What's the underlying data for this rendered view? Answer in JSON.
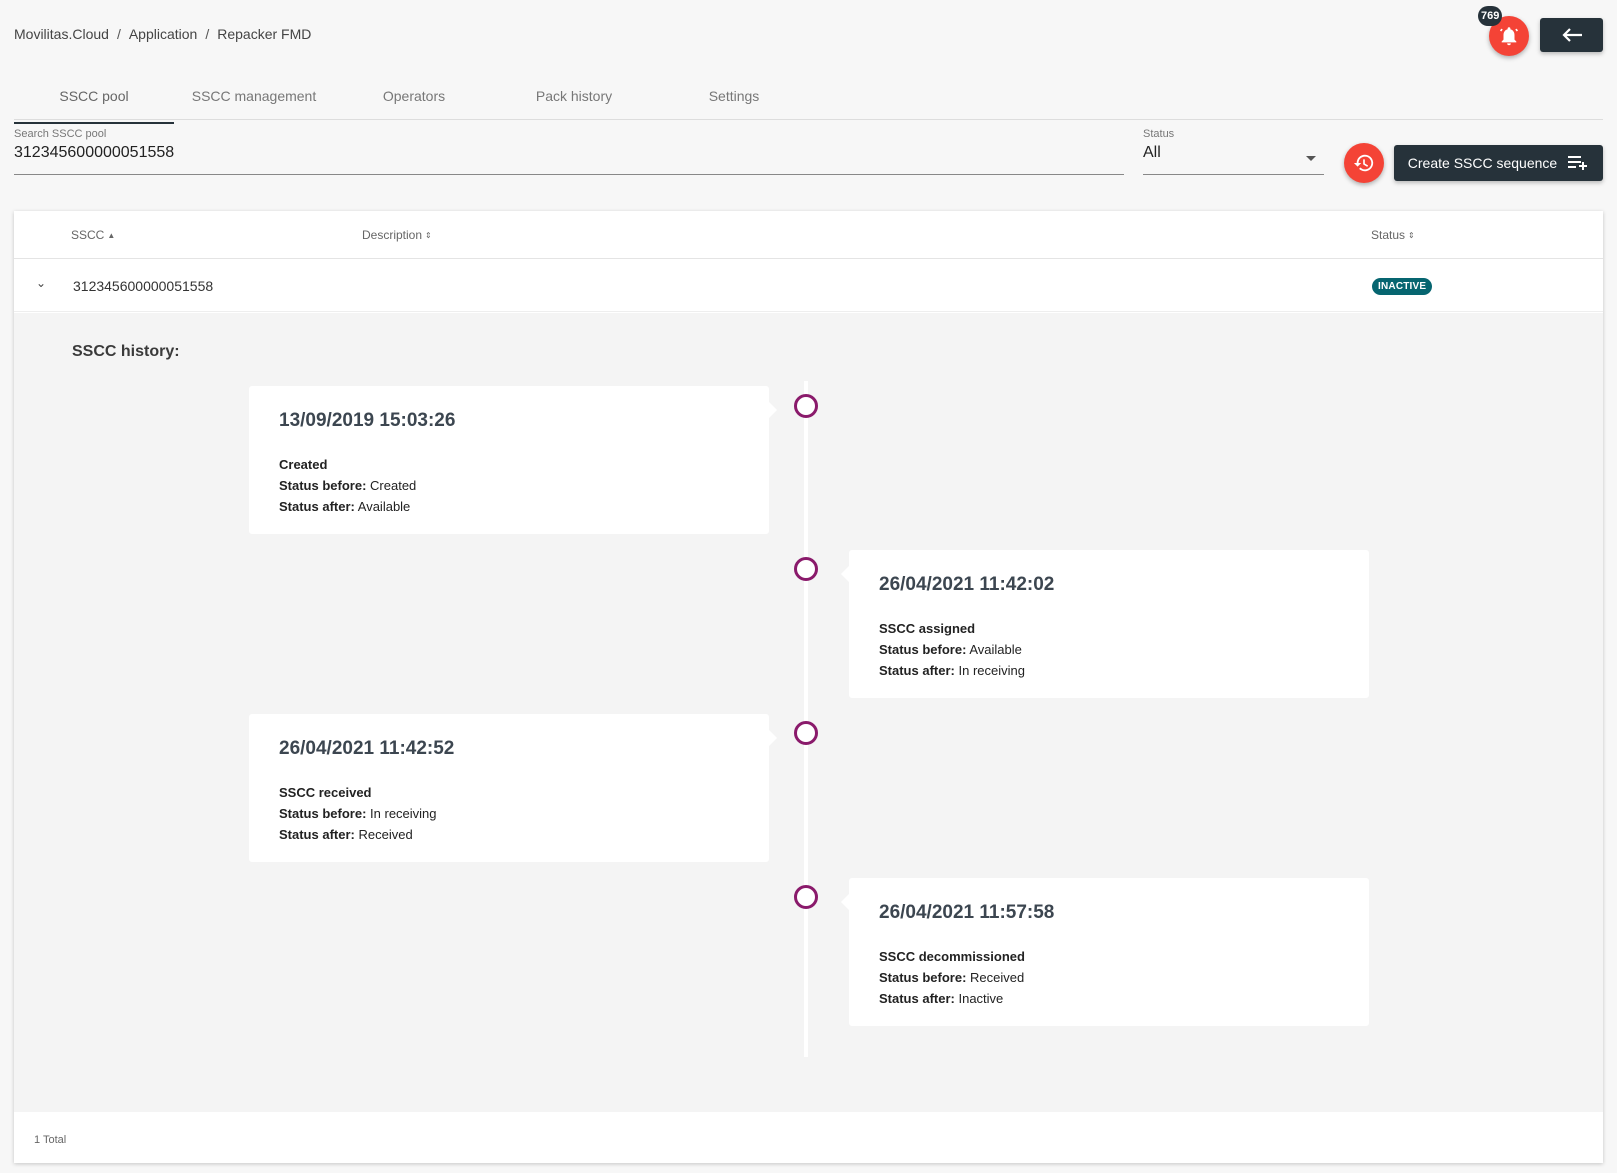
{
  "breadcrumb": [
    "Movilitas.Cloud",
    "Application",
    "Repacker FMD"
  ],
  "header": {
    "notification_count": "769",
    "bell_icon": "bell-icon",
    "back_icon": "arrow-left-icon",
    "accent_color": "#f44336",
    "dark_color": "#26323a"
  },
  "tabs": [
    "SSCC pool",
    "SSCC management",
    "Operators",
    "Pack history",
    "Settings"
  ],
  "active_tab": "SSCC pool",
  "filters": {
    "search_label": "Search SSCC pool",
    "search_value": "312345600000051558",
    "status_label": "Status",
    "status_value": "All",
    "create_label": "Create SSCC sequence"
  },
  "table": {
    "columns": [
      "SSCC",
      "Description",
      "Status"
    ],
    "rows": [
      {
        "sscc": "312345600000051558",
        "description": "",
        "status": "INACTIVE"
      }
    ],
    "status_color": "#066570",
    "total": "1 Total"
  },
  "history": {
    "title": "SSCC history:",
    "events": [
      {
        "date": "13/09/2019 15:03:26",
        "event": "Created",
        "before_label": "Status before:",
        "before": "Created",
        "after_label": "Status after:",
        "after": "Available"
      },
      {
        "date": "26/04/2021 11:42:02",
        "event": "SSCC assigned",
        "before_label": "Status before:",
        "before": "Available",
        "after_label": "Status after:",
        "after": "In receiving"
      },
      {
        "date": "26/04/2021 11:42:52",
        "event": "SSCC received",
        "before_label": "Status before:",
        "before": "In receiving",
        "after_label": "Status after:",
        "after": "Received"
      },
      {
        "date": "26/04/2021 11:57:58",
        "event": "SSCC decommissioned",
        "before_label": "Status before:",
        "before": "Received",
        "after_label": "Status after:",
        "after": "Inactive"
      }
    ],
    "dot_color": "#8a1a6b"
  }
}
